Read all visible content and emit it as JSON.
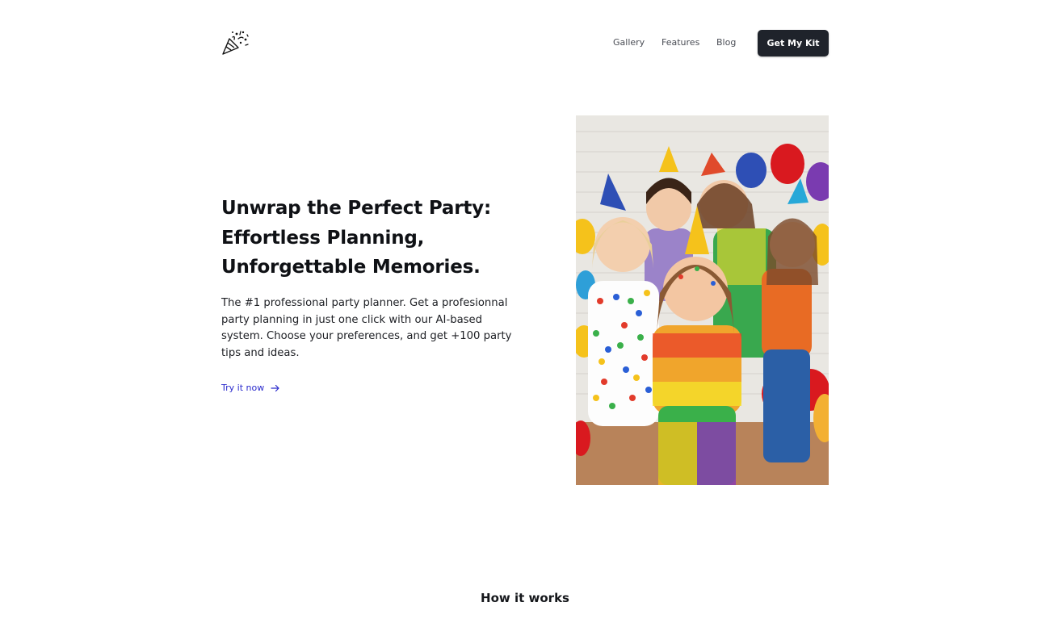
{
  "header": {
    "logo_icon": "party-popper-icon",
    "nav": [
      {
        "label": "Gallery"
      },
      {
        "label": "Features"
      },
      {
        "label": "Blog"
      }
    ],
    "cta_label": "Get My Kit"
  },
  "hero": {
    "title_lines": [
      "Unwrap the Perfect Party:",
      "Effortless Planning,",
      "Unforgettable Memories."
    ],
    "description": "The #1 professional party planner. Get a profesionnal party planning in just one click with our AI-based system. Choose your preferences, and get +100 party tips and ideas.",
    "link_label": "Try it now",
    "link_icon": "arrow-right-icon",
    "image_alt": "Children in party hats with colorful balloons"
  },
  "how_it_works": {
    "title": "How it works"
  },
  "colors": {
    "cta_bg": "#1f232b",
    "link": "#2a2acc",
    "text": "#0f1115"
  }
}
